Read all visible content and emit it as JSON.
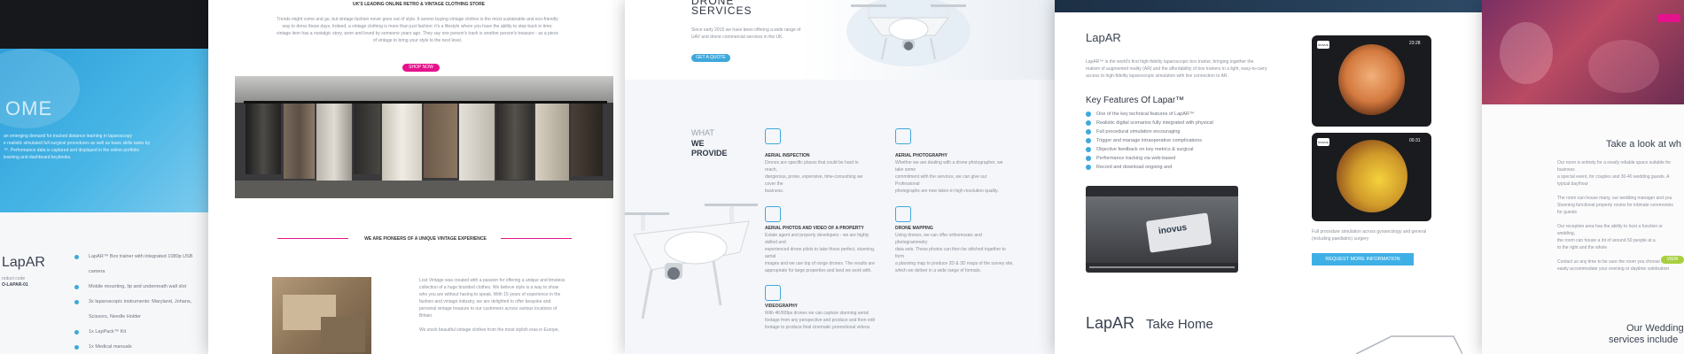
{
  "panel1": {
    "hero_word": "OME",
    "hero_lines": [
      "an emerging demand for tracked distance learning in laparoscopy",
      "e realistic simulated full surgical procedures as well as basic skills tasks by",
      "™. Performance data is captured and displayed in the online portfolio",
      "learning and dashboard keybooks."
    ],
    "logo": "LapAR",
    "product_code_label": "roduct code",
    "product_code": "O-LAPAR-01",
    "features": [
      "LapAR™ Box trainer with integrated 1080p USB camera",
      "Mobile mounting, lip and underneath wall slot",
      "3x laparoscopic instruments: Maryland, Johans, Scissors, Needle Holder",
      "1x LapPack™ Kit",
      "1x Medical manuals"
    ]
  },
  "panel2": {
    "top_heading": "UK'S LEADING ONLINE RETRO & VINTAGE CLOTHING STORE",
    "intro_lines": [
      "Trends might come and go, but vintage fashion never goes out of style. It seems buying vintage clothes is the most sustainable and eco-friendly",
      "way to dress these days. Indeed, a vintage clothing is more than just fashion: it's a lifestyle where you have the ability to step back in time;",
      "vintage item has a nostalgic story, worn and loved by someone years ago. They say one person's trash is another person's treasure - as a piece",
      "of vintage to bring your style to the next level."
    ],
    "shop_button": "SHOP NOW",
    "pioneers_heading": "WE ARE PIONEERS OF A UNIQUE VINTAGE EXPERIENCE",
    "pioneers_lines": [
      "Lost Vintage was created with a passion for offering a unique and timeless",
      "collection of a huge branded clothes. We believe style is a way to show",
      "who you are without having to speak. With 15 years of experience in the",
      "fashion and vintage industry, we are delighted to offer bespoke and",
      "personal vintage treasure to our customers across various locations of",
      "Britain.",
      "",
      "We stock beautiful vintage clothes from the most stylish eras in Europe,"
    ]
  },
  "panel3": {
    "hero_title_line1": "DRONE",
    "hero_title_line2": "SERVICES",
    "hero_lines": [
      "Since early 2015 we have been offering a wide range of",
      "UAV and drone commercial services in the UK."
    ],
    "hero_button": "GET A QUOTE",
    "provide_label_1": "WHAT",
    "provide_label_2": "WE",
    "provide_label_3": "PROVIDE",
    "services": [
      {
        "title": "AERIAL INSPECTION",
        "lines": [
          "Drones are specific places that could be hard to reach,",
          "dangerous, prone, expensive, time-consuming we cover the",
          "business."
        ]
      },
      {
        "title": "AERIAL PHOTOGRAPHY",
        "lines": [
          "Whether we are dealing with a drone photographer, we take some",
          "commitment with the services, we can give our Professional",
          "photographs are now taken in high resolution quality."
        ]
      },
      {
        "title": "AERIAL PHOTOS AND VIDEO OF A PROPERTY",
        "lines": [
          "Estate agent and property developers - we are highly skilled and",
          "experienced drone pilots to take those perfect, stunning, aerial",
          "images and we use top of range drones. The results are",
          "appropriate for large properties and land we work with."
        ]
      },
      {
        "title": "DRONE MAPPING",
        "lines": [
          "Using drones, we can offer orthomosaic and photogrammetry",
          "data sets. These photos can then be stitched together to form",
          "a planning map to produce 2D & 3D maps of the survey site,",
          "which we deliver in a wide range of formats."
        ]
      },
      {
        "title": "VIDEOGRAPHY",
        "lines": [
          "With 4K/60fps drones we can capture stunning aerial",
          "footage from any perspective and produce and then edit",
          "footage to produce final cinematic promotional videos."
        ]
      }
    ]
  },
  "panel4": {
    "logo": "LapAR",
    "intro_lines": [
      "LapAR™ is the world's first high-fidelity laparoscopic box trainer, bringing together the",
      "realism of augmented reality (AR) and the affordability of box trainers in a light, easy-to-carry",
      "access to high-fidelity laparoscopic simulation with live connection to AR."
    ],
    "features_heading": "Key Features Of Lapar™",
    "features": [
      "One of the key technical features of LapAR™",
      "Realistic digital scenarios fully integrated with physical",
      "Full procedural simulation encouraging",
      "Trigger and manage intraoperative complications",
      "Objective feedback on key metrics & surgical",
      "Performance tracking via web-based",
      "Record and download ongoing and"
    ],
    "timer_1": "23:28",
    "timer_2": "00:31",
    "video_brand": "inovus",
    "caption_lines": [
      "Full procedure simulation across gynaecology and general",
      "(including paediatric) surgery"
    ],
    "request_button": "REQUEST MORE INFORMATION",
    "take_home_logo": "LapAR",
    "take_home_text": "Take Home"
  },
  "panel5": {
    "take_look": "Take a look at wh",
    "body_lines": [
      "Our room is entirely for a nearly reliable space suitable for business",
      "a special event, for couples and 30-40 wedding guests. A",
      "typical day/hour",
      "",
      " The room can house many, our wedding manager and you",
      "Stunning functional property rooms for intimate ceremonies",
      "for guests",
      "",
      " Our reception area has the ability to host a function or wedding,",
      "the room can house a lot of around 50 people at a",
      "to the right and the whole",
      "",
      " Contact us any time to be sure the room you choose will",
      "easily accommodate your evening or daytime celebration"
    ],
    "cta_button": "VIEW",
    "weddings_line1": "Our Wedding",
    "weddings_line2": "services include"
  },
  "colors": {
    "accent_blue": "#3fa8dc",
    "pink": "#e5128d",
    "dark": "#2c3440",
    "navy": "#1c2f45"
  }
}
